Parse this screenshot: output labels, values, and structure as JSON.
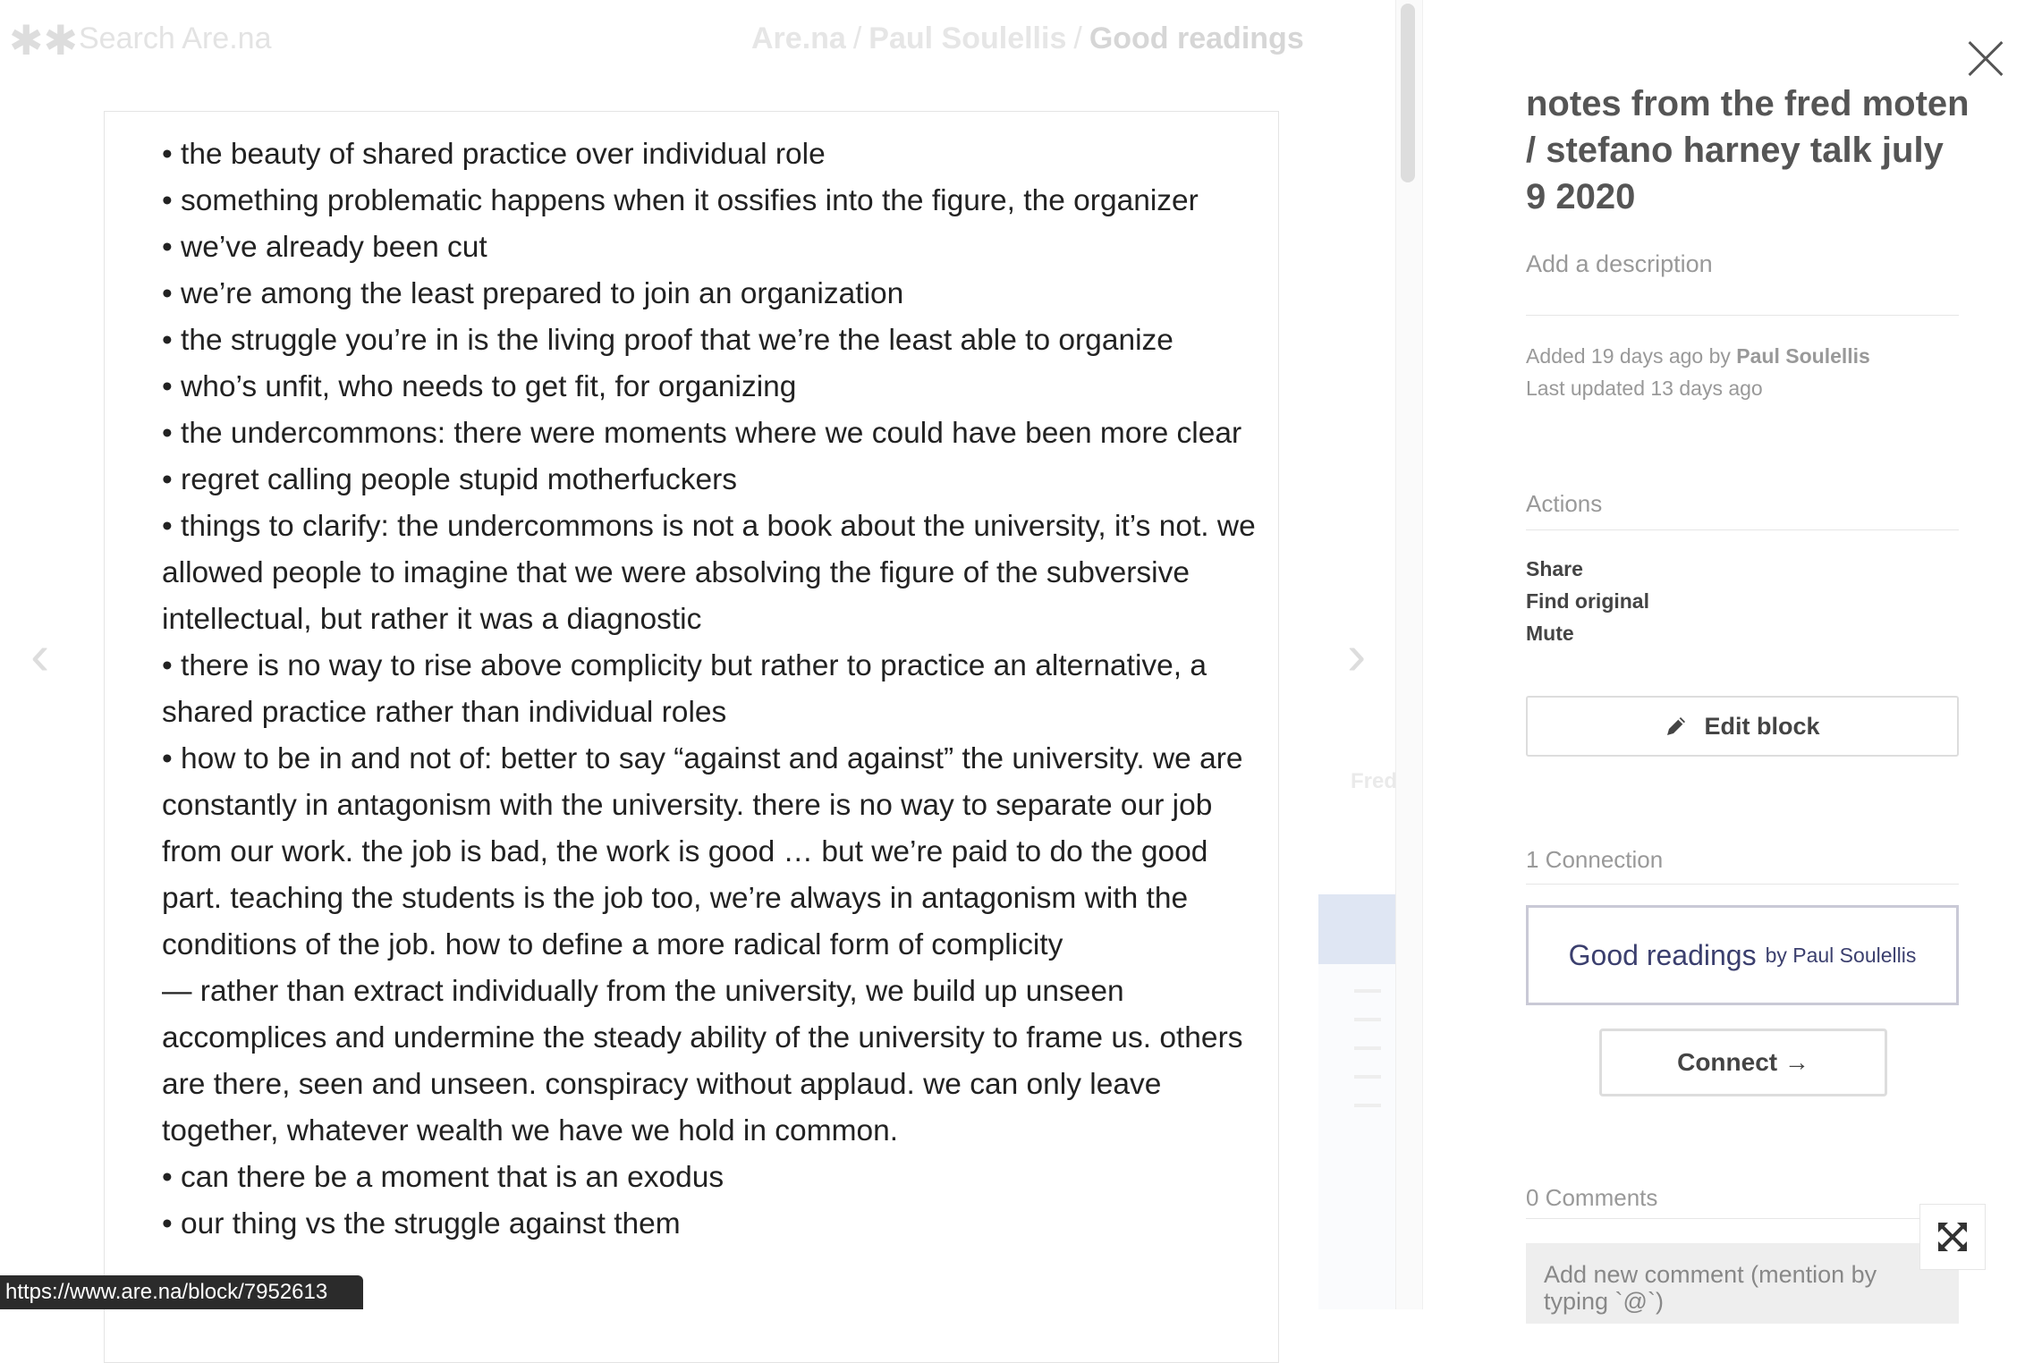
{
  "header": {
    "logo": "✱✱",
    "search_placeholder": "Search Are.na",
    "breadcrumb": [
      "Are.na",
      "Paul Soulellis",
      "Good readings"
    ],
    "separator": "/"
  },
  "block": {
    "lines": [
      "• the beauty of shared practice over individual role",
      "• something problematic happens when it ossifies into the figure, the organizer",
      "• we’ve already been cut",
      "• we’re among the least prepared to join an organization",
      "• the struggle you’re in is the living proof that we’re the least able to organize",
      "• who’s unfit, who needs to get fit, for organizing",
      "• the undercommons: there were moments where we could have been more clear",
      "• regret calling people stupid motherfuckers",
      "• things to clarify: the undercommons is not a book about the university, it’s not. we allowed people to imagine that we were absolving the figure of the subversive intellectual, but rather it was a diagnostic",
      "• there is no way to rise above complicity but rather to practice an alternative, a shared practice rather than individual roles",
      "• how to be in and not of: better to say “against and against” the university. we are constantly in antagonism with the university. there is no way to separate our job from our work. the job is bad, the work is good … but we’re paid to do the good part. teaching the students is the job too, we’re always in antagonism with the conditions of the job. how to define a more radical form of complicity",
      "— rather than extract individually from the university, we build up unseen accomplices and undermine the steady ability of the university to frame us. others are there, seen and unseen. conspiracy without applaud. we can only leave together, whatever wealth we have we hold in common.",
      "• can there be a moment that is an exodus",
      "• our thing vs the struggle against them"
    ]
  },
  "nav": {
    "prev_icon": "chevron-left-icon",
    "next_icon": "chevron-right-icon",
    "prev_glyph": "‹",
    "next_glyph": "›"
  },
  "preview": {
    "label": "Fred Moten"
  },
  "sidebar": {
    "title": "notes from the fred moten / stefano harney talk july 9 2020",
    "description_placeholder": "Add a description",
    "added_prefix": "Added 19 days ago by",
    "added_by": "Paul Soulellis",
    "updated": "Last updated 13 days ago",
    "actions_heading": "Actions",
    "actions": [
      "Share",
      "Find original",
      "Mute"
    ],
    "edit_label": "Edit block",
    "connections_heading": "1 Connection",
    "connection": {
      "title": "Good readings",
      "by": "by Paul Soulellis"
    },
    "connect_label": "Connect →",
    "comments_heading": "0 Comments",
    "comment_placeholder": "Add new comment (mention by typing `@`)"
  },
  "status_bar": {
    "url": "https://www.are.na/block/7952613"
  },
  "colors": {
    "connection_text": "#3b3f6e",
    "connection_border": "#c9c9d6"
  }
}
